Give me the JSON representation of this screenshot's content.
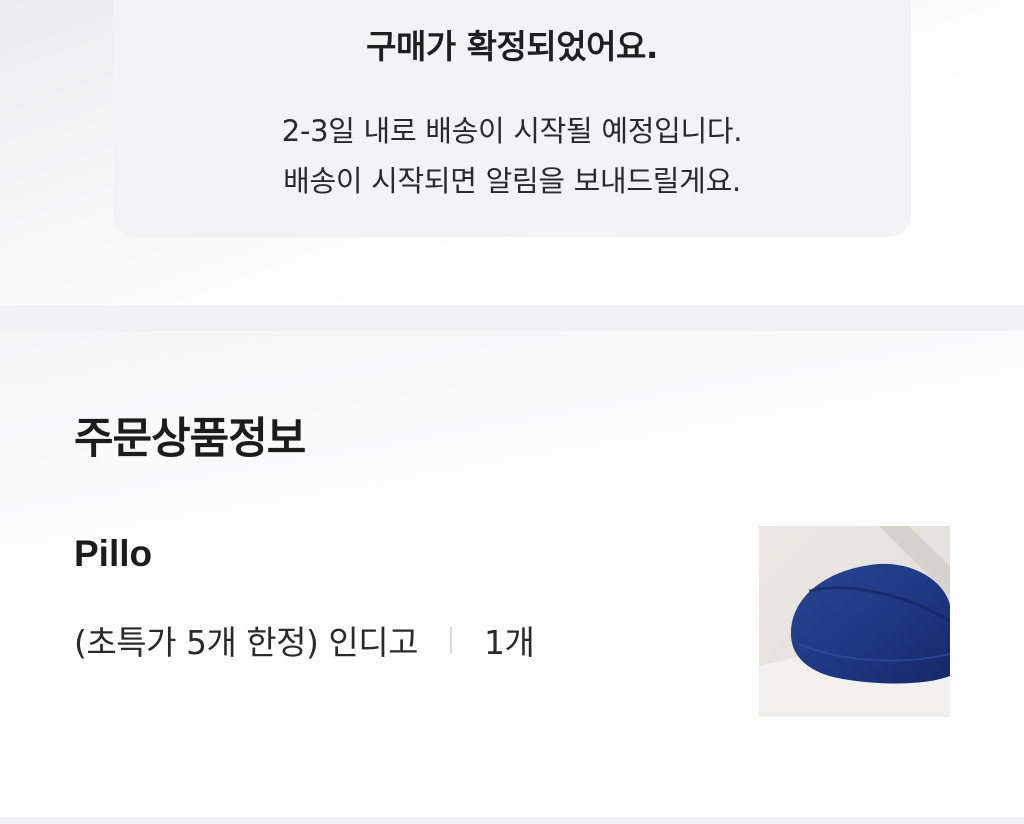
{
  "notice": {
    "title": "구매가 확정되었어요.",
    "line1": "2-3일 내로 배송이 시작될 예정입니다.",
    "line2": "배송이 시작되면 알림을 보내드릴게요."
  },
  "order": {
    "section_title": "주문상품정보",
    "product_name": "Pillo",
    "option_text": "(초특가 5개 한정) 인디고",
    "quantity": "1개",
    "product_color": "#1f3a8a"
  }
}
